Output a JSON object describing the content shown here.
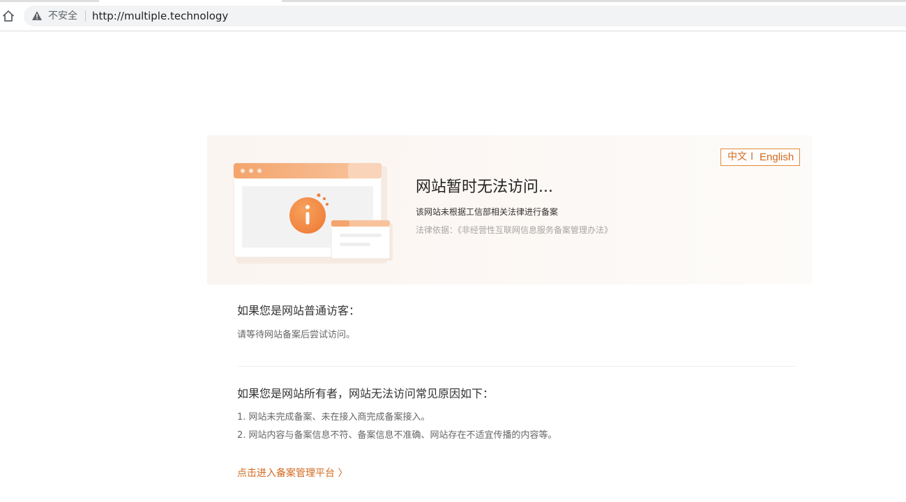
{
  "browser": {
    "security_label": "不安全",
    "url": "http://multiple.technology"
  },
  "banner": {
    "lang_zh": "中文",
    "lang_sep": "I",
    "lang_en": "English",
    "title": "网站暂时无法访问...",
    "description": "该网站未根据工信部相关法律进行备案",
    "law_basis": "法律依据：《非经营性互联网信息服务备案管理办法》"
  },
  "visitor": {
    "heading": "如果您是网站普通访客：",
    "text": "请等待网站备案后尝试访问。"
  },
  "owner": {
    "heading": "如果您是网站所有者，网站无法访问常见原因如下：",
    "reasons": [
      "1. 网站未完成备案、未在接入商完成备案接入。",
      "2. 网站内容与备案信息不符、备案信息不准确、网站存在不适宜传播的内容等。"
    ]
  },
  "link": {
    "label": "点击进入备案管理平台 〉"
  },
  "colors": {
    "accent": "#f08a3c",
    "link": "#d2691e"
  },
  "icons": [
    "home-icon",
    "warning-icon",
    "info-icon"
  ]
}
